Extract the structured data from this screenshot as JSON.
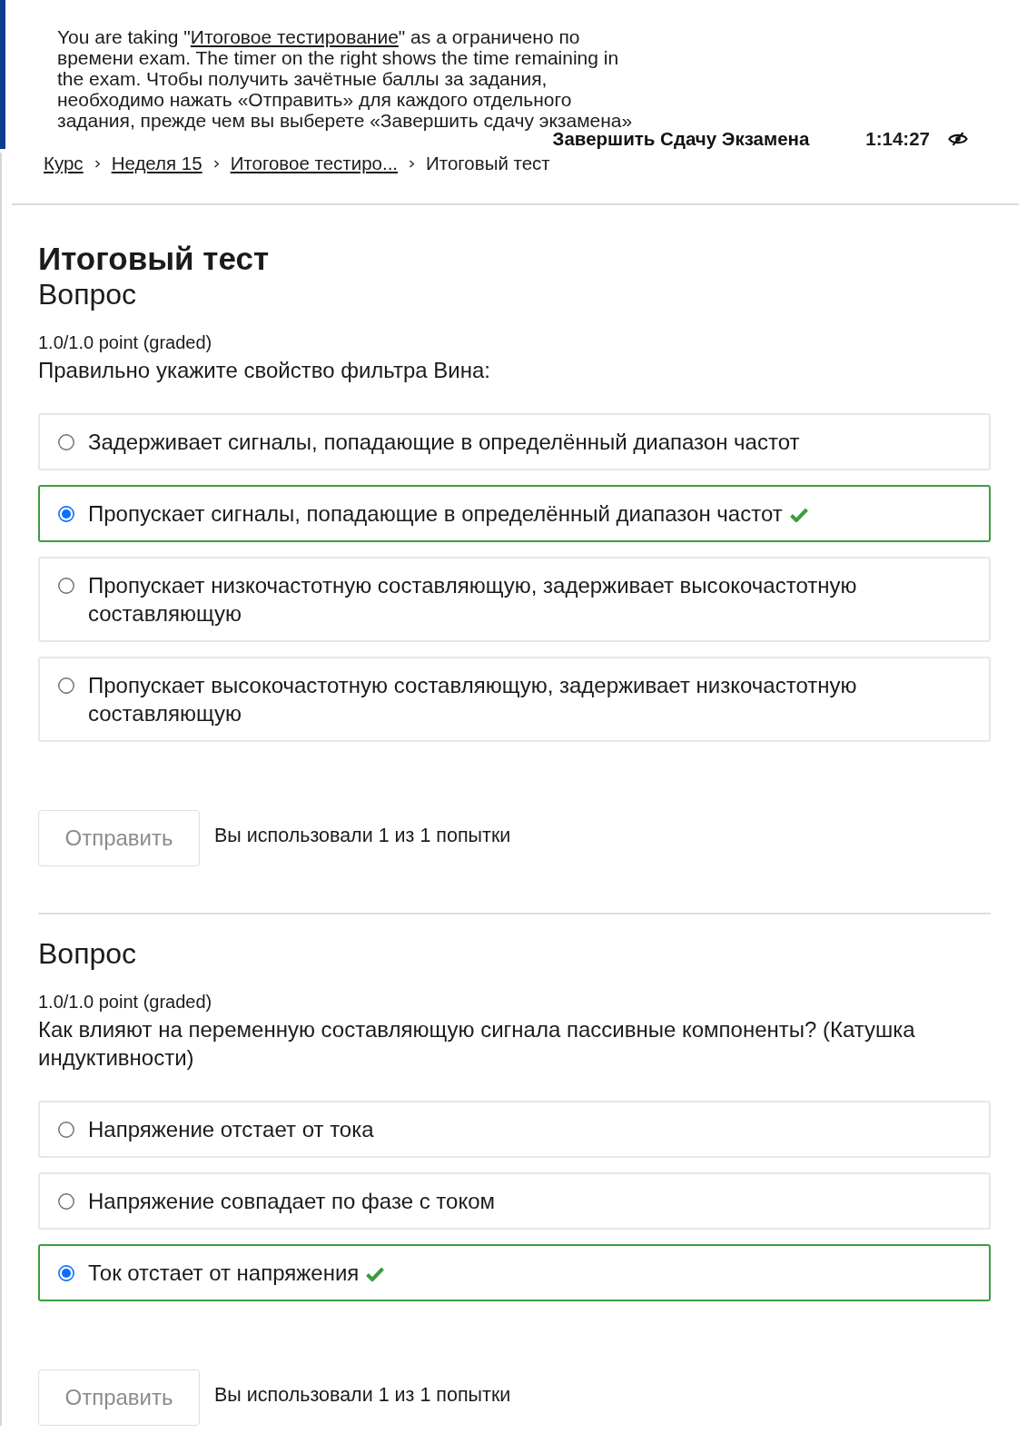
{
  "notice": {
    "text_before": "You are taking \"",
    "link": "Итоговое тестирование",
    "text_after": "\" as a ограничено по времени exam. The timer on the right shows the time remaining in the exam. Чтобы получить зачётные баллы за задания, необходимо нажать «Отправить» для каждого отдельного задания, прежде чем вы выберете «Завершить сдачу экзамена»"
  },
  "timer_bar": {
    "end_button": "Завершить Сдачу Экзамена",
    "time": "1:14:27"
  },
  "breadcrumb": [
    {
      "label": "Курс",
      "current": false
    },
    {
      "label": "Неделя 15",
      "current": false
    },
    {
      "label": "Итоговое тестиро...",
      "current": false
    },
    {
      "label": "Итоговый тест",
      "current": true
    }
  ],
  "title": "Итоговый тест",
  "problems": [
    {
      "heading": "Вопрос",
      "points": "1.0/1.0 point (graded)",
      "question": "Правильно укажите свойство фильтра Вина:",
      "options": [
        {
          "label": "Задерживает сигналы, попадающие в определённый диапазон частот",
          "selected": false,
          "correct": false
        },
        {
          "label": "Пропускает сигналы, попадающие в определённый диапазон частот",
          "selected": true,
          "correct": true
        },
        {
          "label": "Пропускает низкочастотную составляющую, задерживает высокочастотную составляющую",
          "selected": false,
          "correct": false
        },
        {
          "label": "Пропускает высокочастотную составляющую, задерживает низкочастотную составляющую",
          "selected": false,
          "correct": false
        }
      ],
      "submit": {
        "label": "Отправить",
        "disabled": true
      },
      "attempts": "Вы использовали 1 из 1 попытки"
    },
    {
      "heading": "Вопрос",
      "points": "1.0/1.0 point (graded)",
      "question": "Как влияют на переменную составляющую сигнала пассивные компоненты? (Катушка индуктивности)",
      "options": [
        {
          "label": "Напряжение отстает от тока",
          "selected": false,
          "correct": false
        },
        {
          "label": "Напряжение совпадает по фазе с током",
          "selected": false,
          "correct": false
        },
        {
          "label": "Ток отстает от напряжения",
          "selected": true,
          "correct": true
        }
      ],
      "submit": {
        "label": "Отправить",
        "disabled": true
      },
      "attempts": "Вы использовали 1 из 1 попытки"
    }
  ]
}
